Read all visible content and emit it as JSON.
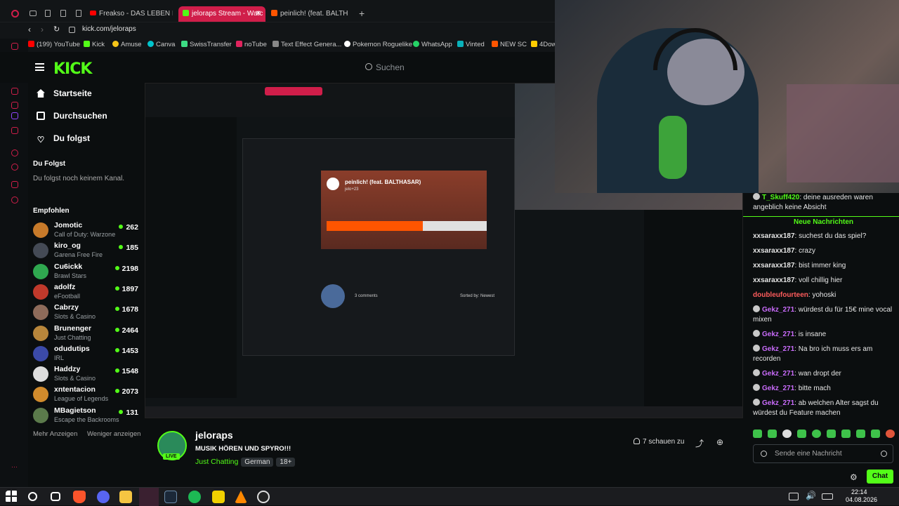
{
  "browser": {
    "tabs": [
      {
        "label": "Freakso - DAS LEBEN IST A",
        "active": false
      },
      {
        "label": "jeloraps Stream - Watc",
        "active": true
      },
      {
        "label": "peinlich! (feat. BALTH",
        "active": false
      }
    ],
    "new_tab_icon": "plus-icon",
    "url": "kick.com/jeloraps",
    "bookmarks": [
      {
        "label": "(199) YouTube",
        "color": "#ff0000"
      },
      {
        "label": "Kick",
        "color": "#53fc18"
      },
      {
        "label": "Amuse",
        "color": "#f5c518"
      },
      {
        "label": "Canva",
        "color": "#00c4cc"
      },
      {
        "label": "SwissTransfer",
        "color": "#3ddc84"
      },
      {
        "label": "noTube",
        "color": "#e0245e"
      },
      {
        "label": "Text Effect Genera...",
        "color": "#888888"
      },
      {
        "label": "Pokemon Roguelike",
        "color": "#ffffff"
      },
      {
        "label": "WhatsApp",
        "color": "#25d366"
      },
      {
        "label": "Vinted",
        "color": "#09b1ba"
      },
      {
        "label": "NEW SC",
        "color": "#ff5500"
      },
      {
        "label": "4Dow",
        "color": "#ffcc00"
      }
    ]
  },
  "site": {
    "brand": "KICK",
    "search_placeholder": "Suchen",
    "nav": [
      {
        "label": "Startseite",
        "icon": "home-icon"
      },
      {
        "label": "Durchsuchen",
        "icon": "browse-icon"
      },
      {
        "label": "Du folgst",
        "icon": "heart-icon"
      }
    ],
    "following_title": "Du Folgst",
    "following_empty": "Du folgst noch keinem Kanal.",
    "recommended_title": "Empfohlen",
    "recommended": [
      {
        "name": "Jomotic",
        "game": "Call of Duty: Warzone",
        "viewers": "262",
        "color": "#c77a2a"
      },
      {
        "name": "kiro_og",
        "game": "Garena Free Fire",
        "viewers": "185",
        "color": "#444a55"
      },
      {
        "name": "Cu6ickk",
        "game": "Brawl Stars",
        "viewers": "2198",
        "color": "#2fa84f"
      },
      {
        "name": "adolfz",
        "game": "eFootball",
        "viewers": "1897",
        "color": "#c0392b"
      },
      {
        "name": "Cabrzy",
        "game": "Slots & Casino",
        "viewers": "1678",
        "color": "#8e6b5a"
      },
      {
        "name": "Brunenger",
        "game": "Just Chatting",
        "viewers": "2464",
        "color": "#b8863b"
      },
      {
        "name": "odudutips",
        "game": "IRL",
        "viewers": "1453",
        "color": "#3b4aa8"
      },
      {
        "name": "Haddzy",
        "game": "Slots & Casino",
        "viewers": "1548",
        "color": "#dddddd"
      },
      {
        "name": "xntentacion",
        "game": "League of Legends",
        "viewers": "2073",
        "color": "#d18b2c"
      },
      {
        "name": "MBagietson",
        "game": "Escape the Backrooms",
        "viewers": "131",
        "color": "#5b7a4b"
      }
    ],
    "show_more": "Mehr Anzeigen",
    "show_less": "Weniger anzeigen"
  },
  "nested_capture": {
    "song_title": "peinlich! (feat. BALTHASAR)",
    "song_artist": "jelo+23",
    "comments_label": "3 comments",
    "sort_label": "Sorted by: Newest"
  },
  "stream": {
    "channel": "jeloraps",
    "title": "MUSIK HÖREN UND SPYRO!!!",
    "category": "Just Chatting",
    "tags": [
      "German",
      "18+"
    ],
    "live_badge": "LIVE",
    "viewers_text": "7 schauen zu"
  },
  "chat": {
    "top_message": {
      "user": "T_Skuff420",
      "text": "deine ausreden waren angeblich keine Absicht",
      "color": "#53fc18"
    },
    "new_messages_label": "Neue Nachrichten",
    "messages": [
      {
        "user": "xxsaraxx187",
        "text": "suchest du das spiel?",
        "color": "#e6e6e6",
        "badge": false
      },
      {
        "user": "xxsaraxx187",
        "text": "crazy",
        "color": "#e6e6e6",
        "badge": false
      },
      {
        "user": "xxsaraxx187",
        "text": "bist immer king",
        "color": "#e6e6e6",
        "badge": false
      },
      {
        "user": "xxsaraxx187",
        "text": "voll chillig hier",
        "color": "#e6e6e6",
        "badge": false
      },
      {
        "user": "doubleufourteen",
        "text": "yohoski",
        "color": "#ff5c5c",
        "badge": false
      },
      {
        "user": "Gekz_271",
        "text": "würdest du für 15€ mine vocal mixen",
        "color": "#c86bfa",
        "badge": true
      },
      {
        "user": "Gekz_271",
        "text": "is insane",
        "color": "#c86bfa",
        "badge": true
      },
      {
        "user": "Gekz_271",
        "text": "Na bro ich muss ers am recorden",
        "color": "#c86bfa",
        "badge": true
      },
      {
        "user": "Gekz_271",
        "text": "wan dropt der",
        "color": "#c86bfa",
        "badge": true
      },
      {
        "user": "Gekz_271",
        "text": "bitte mach",
        "color": "#c86bfa",
        "badge": true
      },
      {
        "user": "Gekz_271",
        "text": "ab welchen Alter sagst du würdest du Feature machen",
        "color": "#c86bfa",
        "badge": true
      }
    ],
    "input_placeholder": "Sende eine Nachricht",
    "send_label": "Chat"
  },
  "taskbar": {
    "time": "22:14",
    "date": "04.08.2026"
  },
  "colors": {
    "accent": "#53fc18",
    "tab_active": "#d01e4a"
  }
}
